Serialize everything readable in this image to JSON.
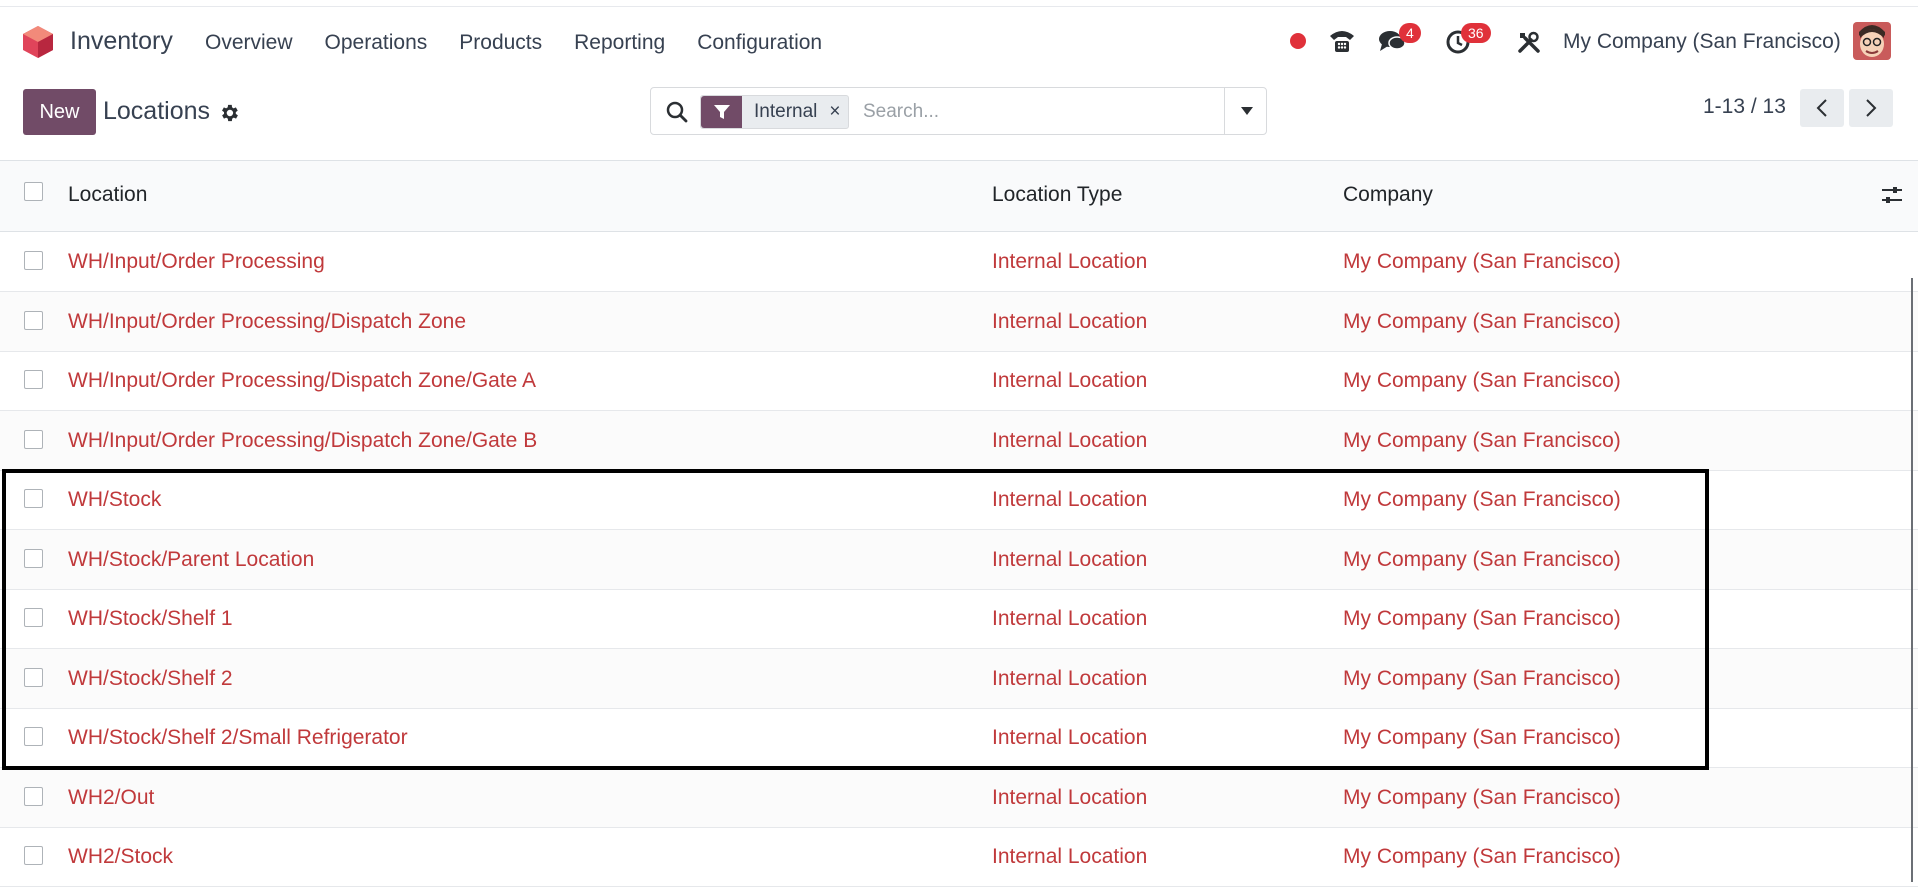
{
  "navbar": {
    "app_name": "Inventory",
    "menu": [
      "Overview",
      "Operations",
      "Products",
      "Reporting",
      "Configuration"
    ],
    "messages_badge": "4",
    "activities_badge": "36",
    "company": "My Company (San Francisco)"
  },
  "control_panel": {
    "new_label": "New",
    "title": "Locations",
    "facet_label": "Internal",
    "facet_remove": "×",
    "search_placeholder": "Search...",
    "pager": "1-13 / 13"
  },
  "table": {
    "headers": [
      "Location",
      "Location Type",
      "Company"
    ],
    "rows": [
      {
        "location": "WH/Input/Order Processing",
        "type": "Internal Location",
        "company": "My Company (San Francisco)"
      },
      {
        "location": "WH/Input/Order Processing/Dispatch Zone",
        "type": "Internal Location",
        "company": "My Company (San Francisco)"
      },
      {
        "location": "WH/Input/Order Processing/Dispatch Zone/Gate A",
        "type": "Internal Location",
        "company": "My Company (San Francisco)"
      },
      {
        "location": "WH/Input/Order Processing/Dispatch Zone/Gate B",
        "type": "Internal Location",
        "company": "My Company (San Francisco)"
      },
      {
        "location": "WH/Stock",
        "type": "Internal Location",
        "company": "My Company (San Francisco)"
      },
      {
        "location": "WH/Stock/Parent Location",
        "type": "Internal Location",
        "company": "My Company (San Francisco)"
      },
      {
        "location": "WH/Stock/Shelf 1",
        "type": "Internal Location",
        "company": "My Company (San Francisco)"
      },
      {
        "location": "WH/Stock/Shelf 2",
        "type": "Internal Location",
        "company": "My Company (San Francisco)"
      },
      {
        "location": "WH/Stock/Shelf 2/Small Refrigerator",
        "type": "Internal Location",
        "company": "My Company (San Francisco)"
      },
      {
        "location": "WH2/Out",
        "type": "Internal Location",
        "company": "My Company (San Francisco)"
      },
      {
        "location": "WH2/Stock",
        "type": "Internal Location",
        "company": "My Company (San Francisco)"
      }
    ]
  },
  "colors": {
    "brand": "#714b67",
    "link": "#c0393b",
    "badge": "#e0313a",
    "record_dot": "#e0313a"
  },
  "icons": [
    "app-logo-icon",
    "record-dot-icon",
    "phone-icon",
    "chat-icon",
    "clock-icon",
    "tools-icon",
    "gear-icon",
    "search-icon",
    "filter-icon",
    "caret-down-icon",
    "chevron-left-icon",
    "chevron-right-icon",
    "optional-columns-icon"
  ]
}
